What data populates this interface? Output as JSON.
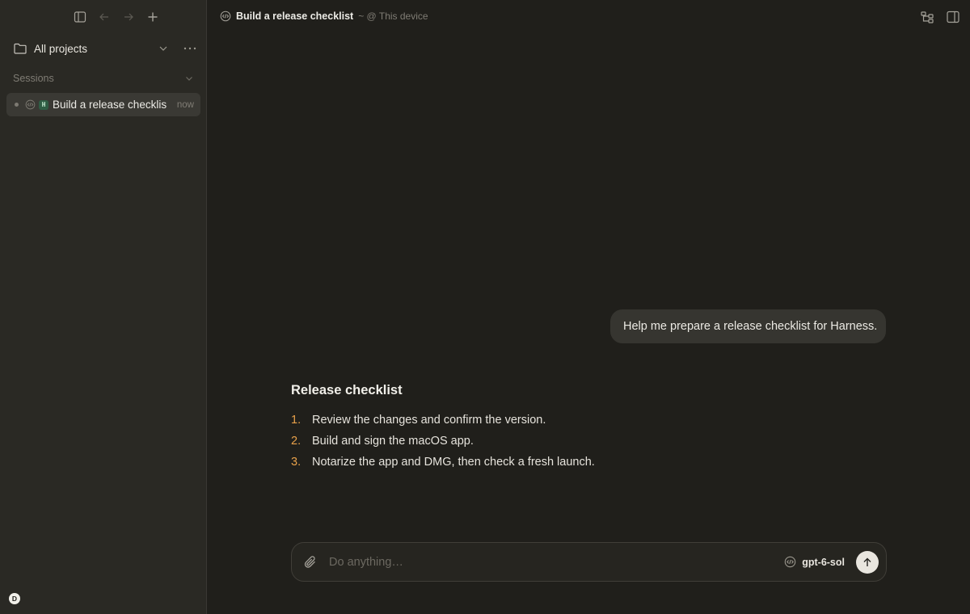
{
  "sidebar": {
    "projects_label": "All projects",
    "sessions_label": "Sessions",
    "sessions": [
      {
        "badge": "H",
        "title": "Build a release checklis",
        "time": "now"
      }
    ],
    "user_initial": "D"
  },
  "header": {
    "title": "Build a release checklist",
    "location": "~ @ This device"
  },
  "chat": {
    "user_message": "Help me prepare a release checklist for Harness.",
    "response": {
      "heading": "Release checklist",
      "items": [
        {
          "num": "1.",
          "text": "Review the changes and confirm the version."
        },
        {
          "num": "2.",
          "text": "Build and sign the macOS app."
        },
        {
          "num": "3.",
          "text": "Notarize the app and DMG, then check a fresh launch."
        }
      ]
    }
  },
  "composer": {
    "placeholder": "Do anything…",
    "model": "gpt-6-sol"
  },
  "colors": {
    "background": "#201f1b",
    "sidebar": "#2a2924",
    "accent_numbers": "#e8a14a",
    "session_badge": "#2f5d44"
  }
}
